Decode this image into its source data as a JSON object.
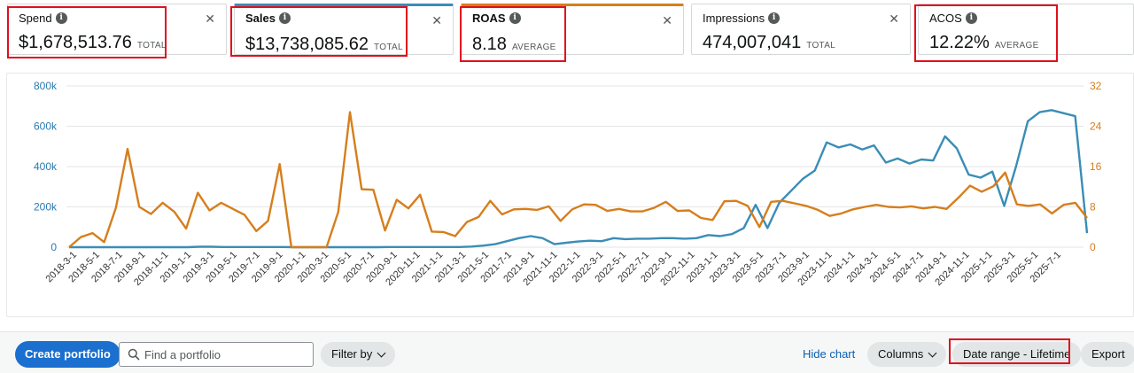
{
  "metrics": [
    {
      "label": "Spend",
      "value": "$1,678,513.76",
      "sub": "TOTAL",
      "info_icon": "info-icon"
    },
    {
      "label": "Sales",
      "value": "$13,738,085.62",
      "sub": "TOTAL",
      "info_icon": "info-icon"
    },
    {
      "label": "ROAS",
      "value": "8.18",
      "sub": "AVERAGE",
      "info_icon": "info-icon"
    },
    {
      "label": "Impressions",
      "value": "474,007,041",
      "sub": "TOTAL",
      "info_icon": "info-icon"
    },
    {
      "label": "ACOS",
      "value": "12.22%",
      "sub": "AVERAGE",
      "info_icon": "info-icon"
    }
  ],
  "close_glyph": "✕",
  "colors": {
    "sales": "#3a8db6",
    "roas": "#d67e1c",
    "highlight": "#e0101d",
    "primary": "#1a6fcf"
  },
  "chart_data": {
    "type": "line",
    "x_ticks": [
      "2018-3-1",
      "2018-5-1",
      "2018-7-1",
      "2018-9-1",
      "2018-11-1",
      "2019-1-1",
      "2019-3-1",
      "2019-5-1",
      "2019-7-1",
      "2019-9-1",
      "2020-1-1",
      "2020-3-1",
      "2020-5-1",
      "2020-7-1",
      "2020-9-1",
      "2020-11-1",
      "2021-1-1",
      "2021-3-1",
      "2021-5-1",
      "2021-7-1",
      "2021-9-1",
      "2021-11-1",
      "2022-1-1",
      "2022-3-1",
      "2022-5-1",
      "2022-7-1",
      "2022-9-1",
      "2022-11-1",
      "2023-1-1",
      "2023-3-1",
      "2023-5-1",
      "2023-7-1",
      "2023-9-1",
      "2023-11-1",
      "2024-1-1",
      "2024-3-1",
      "2024-5-1",
      "2024-7-1",
      "2024-9-1",
      "2024-11-1",
      "2025-1-1",
      "2025-3-1",
      "2025-5-1",
      "2025-7-1"
    ],
    "y_left": {
      "ticks": [
        "0",
        "200k",
        "400k",
        "600k",
        "800k"
      ],
      "range": [
        0,
        800000
      ]
    },
    "y_right": {
      "ticks": [
        "0",
        "8",
        "16",
        "24",
        "32"
      ],
      "range": [
        0,
        32
      ]
    },
    "grid": "horizontal",
    "series": [
      {
        "axis": "left",
        "color": "#3a8db6",
        "values": [
          0,
          0,
          0,
          0,
          0,
          0,
          0,
          0,
          0,
          0,
          0,
          2000,
          2000,
          1000,
          1000,
          1000,
          1000,
          1000,
          1000,
          0,
          0,
          0,
          0,
          0,
          0,
          0,
          0,
          1000,
          1000,
          1000,
          1000,
          1000,
          1000,
          1000,
          3000,
          8000,
          15000,
          30000,
          45000,
          55000,
          45000,
          15000,
          22000,
          28000,
          32000,
          30000,
          45000,
          40000,
          42000,
          42000,
          45000,
          45000,
          42000,
          45000,
          60000,
          55000,
          65000,
          95000,
          210000,
          95000,
          220000,
          280000,
          340000,
          380000,
          520000,
          495000,
          510000,
          485000,
          505000,
          420000,
          440000,
          415000,
          435000,
          430000,
          550000,
          490000,
          360000,
          345000,
          375000,
          205000,
          400000,
          625000,
          670000,
          680000,
          665000,
          650000,
          70000
        ]
      },
      {
        "axis": "right",
        "color": "#d67e1c",
        "values": [
          0,
          2,
          2.8,
          1,
          7.8,
          19.5,
          8,
          6.6,
          8.8,
          7,
          3.7,
          10.8,
          7.3,
          8.8,
          7.6,
          6.4,
          3.2,
          5.2,
          16.5,
          0,
          0,
          0,
          0,
          7,
          26.8,
          11.5,
          11.4,
          3.3,
          9.4,
          7.7,
          10.4,
          3.1,
          3,
          2.2,
          5,
          6,
          9.2,
          6.5,
          7.5,
          7.6,
          7.4,
          8.1,
          5.2,
          7.5,
          8.5,
          8.4,
          7.2,
          7.6,
          7.1,
          7.1,
          7.8,
          9,
          7.2,
          7.3,
          5.8,
          5.4,
          9.1,
          9.2,
          8.2,
          4,
          9,
          9.2,
          8.7,
          8.2,
          7.4,
          6.2,
          6.7,
          7.5,
          8,
          8.4,
          8,
          7.9,
          8.1,
          7.7,
          8,
          7.6,
          9.8,
          12.2,
          11,
          12.1,
          14.8,
          8.5,
          8.2,
          8.5,
          6.7,
          8.4,
          8.8,
          5.8
        ]
      }
    ]
  },
  "toolbar": {
    "create_label": "Create portfolio",
    "search_placeholder": "Find a portfolio",
    "filter_label": "Filter by",
    "hide_chart_label": "Hide chart",
    "columns_label": "Columns",
    "date_range_label": "Date range - Lifetime",
    "export_label": "Export"
  }
}
